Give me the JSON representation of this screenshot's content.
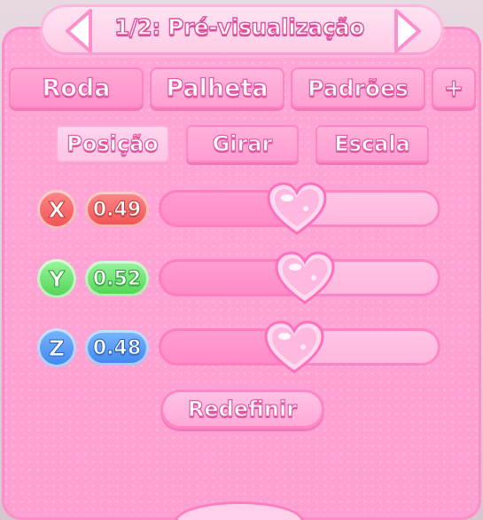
{
  "title": "1/2: Pré-visualização",
  "nav": {
    "prev_icon": "left-arrow-icon",
    "next_icon": "right-arrow-icon"
  },
  "tabs": [
    {
      "label": "Roda"
    },
    {
      "label": "Palheta"
    },
    {
      "label": "Padrões"
    },
    {
      "label": "+"
    }
  ],
  "subtabs": [
    {
      "label": "Posição",
      "selected": true
    },
    {
      "label": "Girar"
    },
    {
      "label": "Escala"
    }
  ],
  "axes": [
    {
      "axis": "X",
      "value": "0.49",
      "level": 0.49,
      "color": "#ef5151"
    },
    {
      "axis": "Y",
      "value": "0.52",
      "level": 0.52,
      "color": "#4fd354"
    },
    {
      "axis": "Z",
      "value": "0.48",
      "level": 0.48,
      "color": "#3f85ee"
    }
  ],
  "reset_label": "Redefinir",
  "thumb_icon": "heart-icon",
  "colors": {
    "panel": "#ffa0d2",
    "accent": "#e45aa5"
  }
}
